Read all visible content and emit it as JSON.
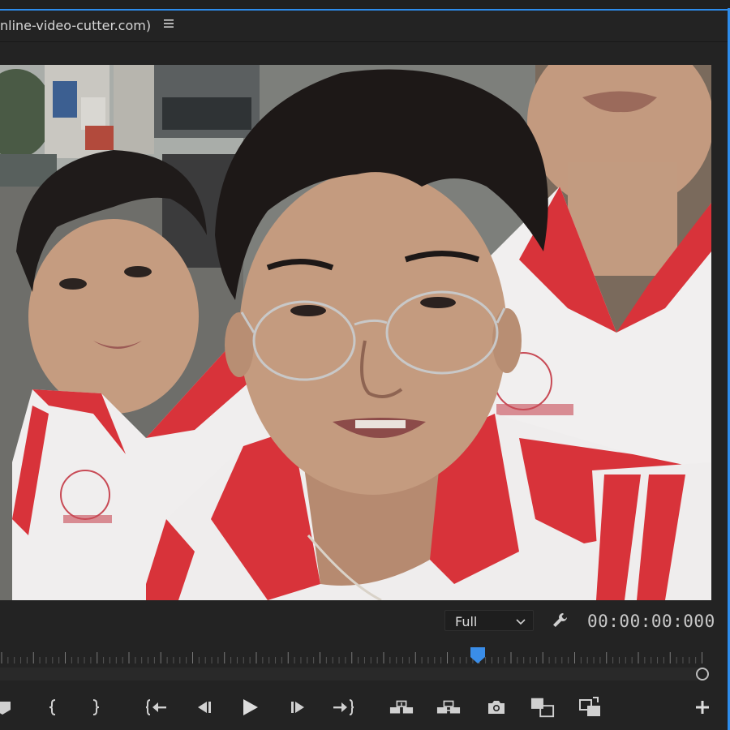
{
  "panel": {
    "title": "nline-video-cutter.com)",
    "menu_icon": "hamburger-icon"
  },
  "video": {
    "description_icon": "video-frame"
  },
  "controls": {
    "zoom_value": "Full",
    "settings_icon": "wrench-icon",
    "timecode": "00:00:00:000"
  },
  "timeline": {
    "playhead_position": 0.67
  },
  "transport": {
    "buttons": [
      "add-marker-icon",
      "mark-in-icon",
      "mark-out-icon",
      "go-to-in-icon",
      "step-back-icon",
      "play-icon",
      "step-forward-icon",
      "go-to-out-icon",
      "lift-icon",
      "extract-icon",
      "export-frame-icon",
      "comparison-view-icon",
      "toggle-proxies-icon",
      "add-button-icon"
    ]
  },
  "colors": {
    "accent": "#2d8ceb",
    "playhead": "#3a8de8",
    "panel_bg": "#232323",
    "jersey_red": "#d8333a"
  }
}
